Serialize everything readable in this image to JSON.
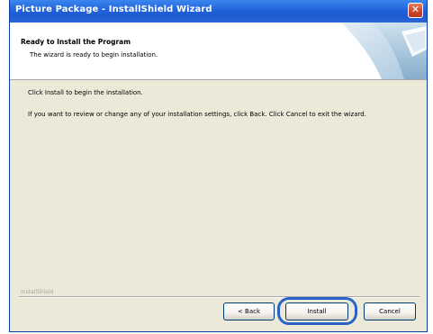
{
  "window": {
    "title": "Picture Package - InstallShield Wizard",
    "close_glyph": "✕"
  },
  "header": {
    "title": "Ready to Install the Program",
    "subtitle": "The wizard is ready to begin installation."
  },
  "body": {
    "line1": "Click Install to begin the installation.",
    "line2": "If you want to review or change any of your installation settings, click Back. Click Cancel to exit the wizard."
  },
  "footer": {
    "brand": "InstallShield"
  },
  "buttons": {
    "back": "< Back",
    "install": "Install",
    "cancel": "Cancel"
  },
  "highlighted_button": "install"
}
